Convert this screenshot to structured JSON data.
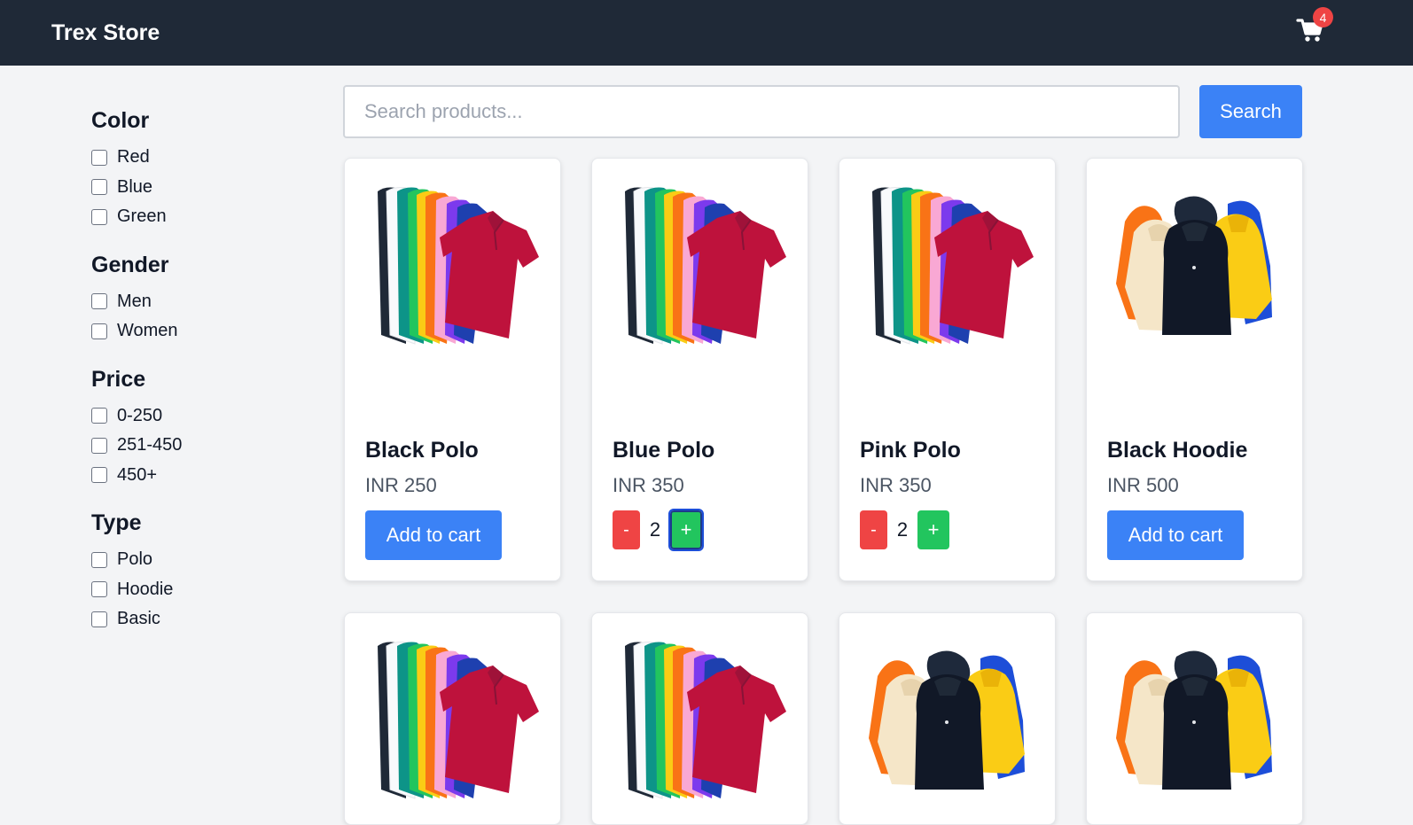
{
  "app": {
    "title": "Trex Store"
  },
  "cart": {
    "count": "4",
    "icon": "cart-icon"
  },
  "search": {
    "placeholder": "Search products...",
    "value": "",
    "button_label": "Search"
  },
  "filters": [
    {
      "title": "Color",
      "options": [
        "Red",
        "Blue",
        "Green"
      ]
    },
    {
      "title": "Gender",
      "options": [
        "Men",
        "Women"
      ]
    },
    {
      "title": "Price",
      "options": [
        "0-250",
        "251-450",
        "450+"
      ]
    },
    {
      "title": "Type",
      "options": [
        "Polo",
        "Hoodie",
        "Basic"
      ]
    }
  ],
  "products": [
    {
      "name": "Black Polo",
      "price": "INR 250",
      "image": "polo-shirts-image",
      "in_cart": false,
      "action_label": "Add to cart"
    },
    {
      "name": "Blue Polo",
      "price": "INR 350",
      "image": "polo-shirts-image",
      "in_cart": true,
      "qty": "2",
      "minus_label": "-",
      "plus_label": "+"
    },
    {
      "name": "Pink Polo",
      "price": "INR 350",
      "image": "polo-shirts-image",
      "in_cart": true,
      "qty": "2",
      "minus_label": "-",
      "plus_label": "+"
    },
    {
      "name": "Black Hoodie",
      "price": "INR 500",
      "image": "hoodies-image",
      "in_cart": false,
      "action_label": "Add to cart"
    },
    {
      "image": "polo-shirts-image"
    },
    {
      "image": "polo-shirts-image"
    },
    {
      "image": "hoodies-image"
    },
    {
      "image": "hoodies-image"
    }
  ],
  "colors": {
    "navbar": "#1f2937",
    "primary": "#3b82f6",
    "minus": "#ef4444",
    "plus": "#22c55e",
    "badge": "#ef4444"
  }
}
